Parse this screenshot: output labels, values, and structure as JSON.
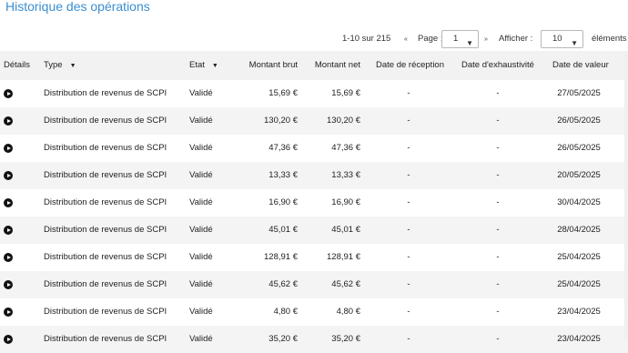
{
  "title": "Historique des opérations",
  "pager": {
    "range": "1-10 sur 215",
    "prev_icon": "«",
    "page_label": "Page :",
    "page_value": "1",
    "next_icon": "»",
    "show_label": "Afficher :",
    "page_size": "10",
    "elements_label": "éléments"
  },
  "columns": {
    "details": "Détails",
    "type": "Type",
    "etat": "Etat",
    "brut": "Montant brut",
    "net": "Montant net",
    "reception": "Date de réception",
    "exhaustivite": "Date d'exhaustivité",
    "valeur": "Date de valeur"
  },
  "rows": [
    {
      "type": "Distribution de revenus de SCPI",
      "etat": "Validé",
      "brut": "15,69 €",
      "net": "15,69 €",
      "reception": "-",
      "exhaustivite": "-",
      "valeur": "27/05/2025"
    },
    {
      "type": "Distribution de revenus de SCPI",
      "etat": "Validé",
      "brut": "130,20 €",
      "net": "130,20 €",
      "reception": "-",
      "exhaustivite": "-",
      "valeur": "26/05/2025"
    },
    {
      "type": "Distribution de revenus de SCPI",
      "etat": "Validé",
      "brut": "47,36 €",
      "net": "47,36 €",
      "reception": "-",
      "exhaustivite": "-",
      "valeur": "26/05/2025"
    },
    {
      "type": "Distribution de revenus de SCPI",
      "etat": "Validé",
      "brut": "13,33 €",
      "net": "13,33 €",
      "reception": "-",
      "exhaustivite": "-",
      "valeur": "20/05/2025"
    },
    {
      "type": "Distribution de revenus de SCPI",
      "etat": "Validé",
      "brut": "16,90 €",
      "net": "16,90 €",
      "reception": "-",
      "exhaustivite": "-",
      "valeur": "30/04/2025"
    },
    {
      "type": "Distribution de revenus de SCPI",
      "etat": "Validé",
      "brut": "45,01 €",
      "net": "45,01 €",
      "reception": "-",
      "exhaustivite": "-",
      "valeur": "28/04/2025"
    },
    {
      "type": "Distribution de revenus de SCPI",
      "etat": "Validé",
      "brut": "128,91 €",
      "net": "128,91 €",
      "reception": "-",
      "exhaustivite": "-",
      "valeur": "25/04/2025"
    },
    {
      "type": "Distribution de revenus de SCPI",
      "etat": "Validé",
      "brut": "45,62 €",
      "net": "45,62 €",
      "reception": "-",
      "exhaustivite": "-",
      "valeur": "25/04/2025"
    },
    {
      "type": "Distribution de revenus de SCPI",
      "etat": "Validé",
      "brut": "4,80 €",
      "net": "4,80 €",
      "reception": "-",
      "exhaustivite": "-",
      "valeur": "23/04/2025"
    },
    {
      "type": "Distribution de revenus de SCPI",
      "etat": "Validé",
      "brut": "35,20 €",
      "net": "35,20 €",
      "reception": "-",
      "exhaustivite": "-",
      "valeur": "23/04/2025"
    }
  ],
  "colors": {
    "title": "#3b8ed0",
    "header_bg": "#f2f2f2",
    "row_alt": "#f4f4f4"
  },
  "icons": {
    "details": "play-circle-icon",
    "sort": "caret-down-icon",
    "select": "chevron-down-icon"
  }
}
